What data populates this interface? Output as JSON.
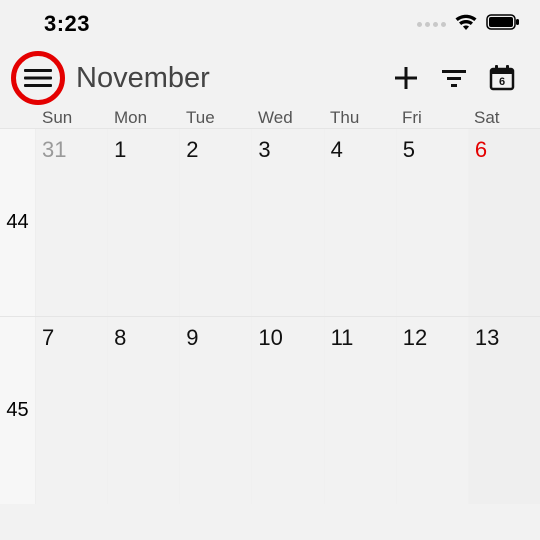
{
  "status": {
    "time": "3:23"
  },
  "header": {
    "month": "November",
    "today_badge": "6"
  },
  "day_labels": [
    "Sun",
    "Mon",
    "Tue",
    "Wed",
    "Thu",
    "Fri",
    "Sat"
  ],
  "weeks": [
    {
      "num": "44",
      "days": [
        {
          "d": "31",
          "prev": true
        },
        {
          "d": "1"
        },
        {
          "d": "2"
        },
        {
          "d": "3"
        },
        {
          "d": "4"
        },
        {
          "d": "5"
        },
        {
          "d": "6",
          "today": true
        }
      ]
    },
    {
      "num": "45",
      "days": [
        {
          "d": "7"
        },
        {
          "d": "8"
        },
        {
          "d": "9"
        },
        {
          "d": "10"
        },
        {
          "d": "11"
        },
        {
          "d": "12"
        },
        {
          "d": "13"
        }
      ]
    }
  ]
}
